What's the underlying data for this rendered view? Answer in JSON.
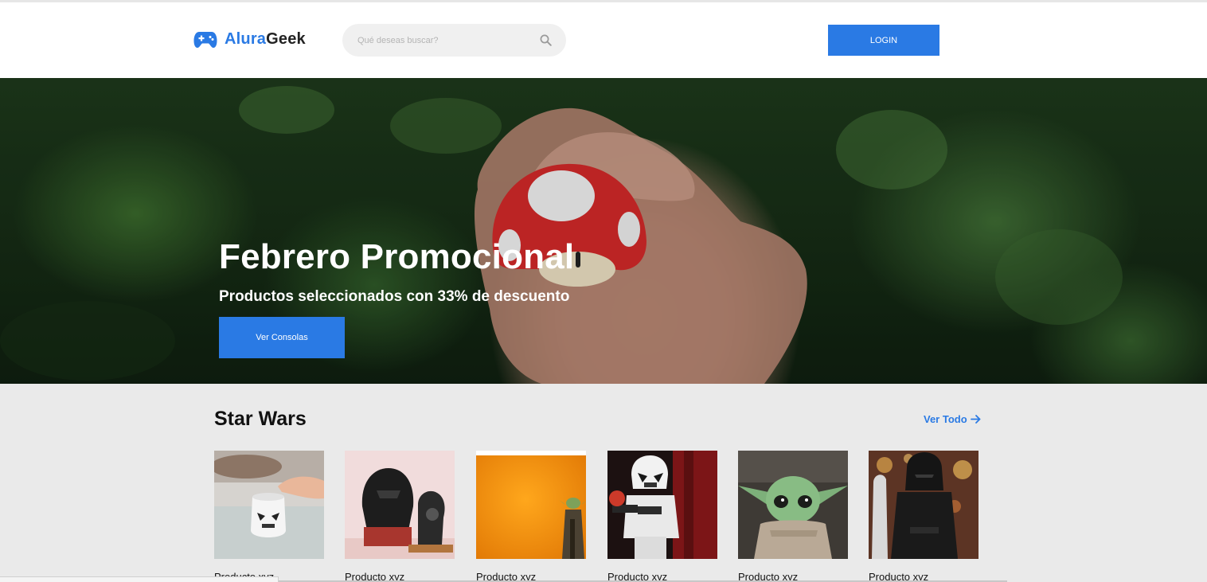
{
  "brand": {
    "part1": "Alura",
    "part2": "Geek",
    "accent": "#2a7ae4",
    "icon": "gamepad-icon"
  },
  "search": {
    "placeholder": "Qué deseas buscar?",
    "value": "",
    "icon": "search-icon"
  },
  "header": {
    "login_label": "LOGIN"
  },
  "hero": {
    "title": "Febrero Promocional",
    "subtitle": "Productos seleccionados con 33% de descuento",
    "button_label": "Ver Consolas"
  },
  "section": {
    "title": "Star Wars",
    "view_all": "Ver Todo",
    "products": [
      {
        "name": "Producto xyz",
        "image": "stormtrooper-mug-image"
      },
      {
        "name": "Producto xyz",
        "image": "darth-vader-lego-image"
      },
      {
        "name": "Producto xyz",
        "image": "yoda-orange-image"
      },
      {
        "name": "Producto xyz",
        "image": "stormtrooper-figure-image"
      },
      {
        "name": "Producto xyz",
        "image": "baby-yoda-image"
      },
      {
        "name": "Producto xyz",
        "image": "kylo-ren-image"
      }
    ]
  }
}
